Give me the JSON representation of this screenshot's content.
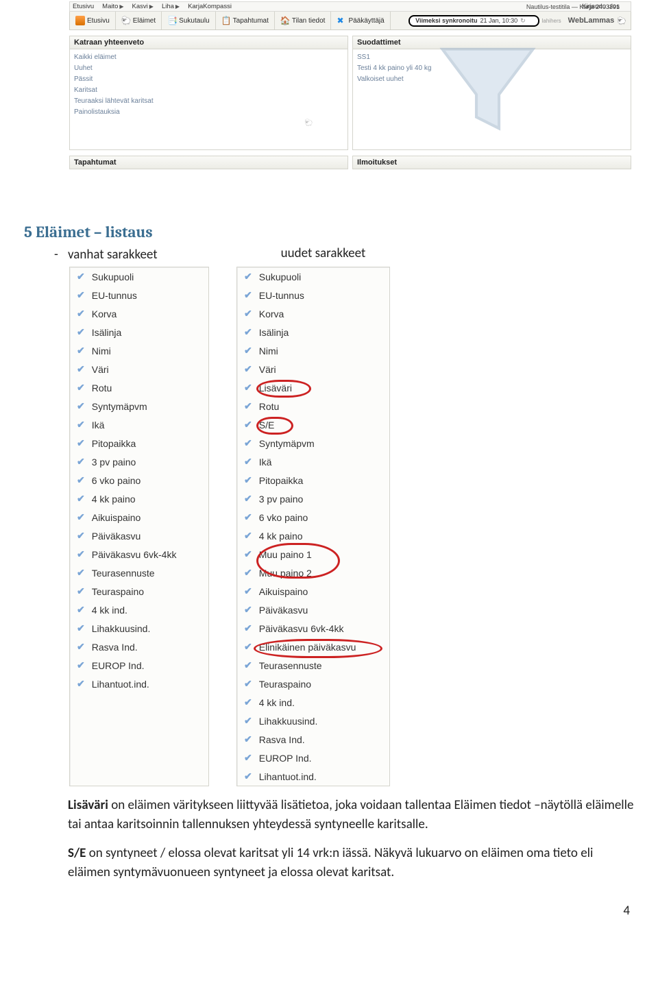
{
  "menu": {
    "etusivu": "Etusivu",
    "maito": "Maito",
    "kasvi": "Kasvi",
    "liha": "Liha",
    "karjakompassi": "KarjaKompassi",
    "logout": "Kirjaudu ulos"
  },
  "toolbar": {
    "etusivu": "Etusivu",
    "elaimet": "Eläimet",
    "sukutaulu": "Sukutaulu",
    "tapahtumat": "Tapahtumat",
    "tilantiedot": "Tilan tiedot",
    "paakayttaja": "Pääkäyttäjä",
    "brand_prefix": "Nautilus-testitila",
    "brand_sep": "—",
    "brand_karja": "Karja",
    "brand_id": "2403391",
    "brand_name": "WebLammas",
    "brand_small": "lahihers",
    "sync_label": "Viimeksi synkronoitu",
    "sync_time": "21 Jan, 10:30",
    "sync_btn": "↻"
  },
  "panels": {
    "katraa_hd": "Katraan yhteenveto",
    "suod_hd": "Suodattimet",
    "tapaht_hd": "Tapahtumat",
    "ilmoit_hd": "Ilmoitukset",
    "links": {
      "l0": "Kaikki eläimet",
      "l1": "Uuhet",
      "l2": "Pässit",
      "l3": "Karitsat",
      "l4": "Teuraaksi lähtevät karitsat",
      "l5": "Painolistauksia"
    },
    "filters": {
      "f0": "SS1",
      "f1": "Testi 4 kk paino yli 40 kg",
      "f2": "Valkoiset uuhet"
    }
  },
  "doc": {
    "heading": "5 Eläimet – listaus",
    "bullet": "vanhat sarakkeet",
    "col2_title": "uudet sarakkeet",
    "pagenum": "4"
  },
  "cols_old": {
    "c0": "Sukupuoli",
    "c1": "EU-tunnus",
    "c2": "Korva",
    "c3": "Isälinja",
    "c4": "Nimi",
    "c5": "Väri",
    "c6": "Rotu",
    "c7": "Syntymäpvm",
    "c8": "Ikä",
    "c9": "Pitopaikka",
    "c10": "3 pv paino",
    "c11": "6 vko paino",
    "c12": "4 kk paino",
    "c13": "Aikuispaino",
    "c14": "Päiväkasvu",
    "c15": "Päiväkasvu 6vk-4kk",
    "c16": "Teurasennuste",
    "c17": "Teuraspaino",
    "c18": "4 kk ind.",
    "c19": "Lihakkuusind.",
    "c20": "Rasva Ind.",
    "c21": "EUROP Ind.",
    "c22": "Lihantuot.ind."
  },
  "cols_new": {
    "n0": "Sukupuoli",
    "n1": "EU-tunnus",
    "n2": "Korva",
    "n3": "Isälinja",
    "n4": "Nimi",
    "n5": "Väri",
    "n6": "Lisäväri",
    "n7": "Rotu",
    "n8": "S/E",
    "n9": "Syntymäpvm",
    "n10": "Ikä",
    "n11": "Pitopaikka",
    "n12": "3 pv paino",
    "n13": "6 vko paino",
    "n14": "4 kk paino",
    "n15": "Muu paino 1",
    "n16": "Muu paino 2",
    "n17": "Aikuispaino",
    "n18": "Päiväkasvu",
    "n19": "Päiväkasvu 6vk-4kk",
    "n20": "Elinikäinen päiväkasvu",
    "n21": "Teurasennuste",
    "n22": "Teuraspaino",
    "n23": "4 kk ind.",
    "n24": "Lihakkuusind.",
    "n25": "Rasva Ind.",
    "n26": "EUROP Ind.",
    "n27": "Lihantuot.ind."
  },
  "para": {
    "p1a": "Lisäväri",
    "p1b": " on eläimen väritykseen liittyvää lisätietoa, joka voidaan tallentaa Eläimen tiedot –näytöllä eläimelle tai antaa karitsoinnin tallennuksen yhteydessä syntyneelle karitsalle.",
    "p2a": "S/E",
    "p2b": " on syntyneet / elossa olevat karitsat yli 14 vrk:n iässä. Näkyvä lukuarvo on eläimen oma tieto eli eläimen syntymävuonueen syntyneet ja elossa olevat karitsat."
  }
}
